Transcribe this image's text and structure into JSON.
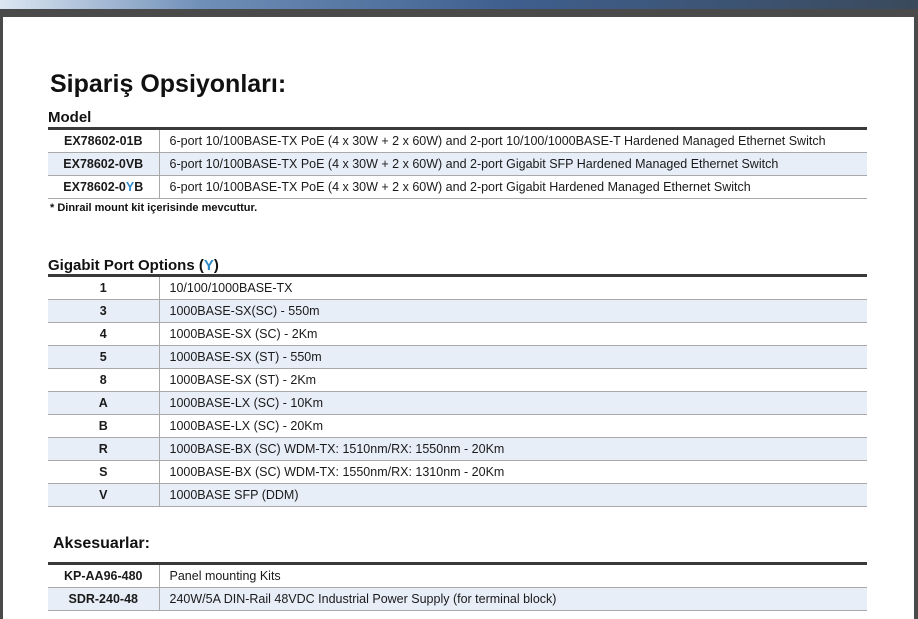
{
  "page_title": "Sipariş Opsiyonları:",
  "model_section": {
    "label": "Model",
    "rows": [
      {
        "code": "EX78602-01B",
        "desc": "6-port 10/100BASE-TX PoE (4 x 30W + 2 x 60W) and 2-port 10/100/1000BASE-T Hardened Managed Ethernet Switch"
      },
      {
        "code": "EX78602-0VB",
        "desc": "6-port 10/100BASE-TX PoE (4 x 30W + 2 x 60W) and 2-port Gigabit SFP Hardened Managed Ethernet Switch"
      },
      {
        "code_prefix": "EX78602-0",
        "code_highlight": "Y",
        "code_suffix": "B",
        "desc": "6-port 10/100BASE-TX PoE (4 x 30W + 2 x 60W) and 2-port Gigabit Hardened Managed Ethernet Switch"
      }
    ],
    "footnote": "*  Dinrail mount kit içerisinde mevcuttur."
  },
  "gigabit_section": {
    "label": "Gigabit Port Options (",
    "label_highlight": "Y",
    "label_suffix": ")",
    "rows": [
      {
        "code": "1",
        "desc": "10/100/1000BASE-TX"
      },
      {
        "code": "3",
        "desc": "1000BASE-SX(SC) - 550m"
      },
      {
        "code": "4",
        "desc": "1000BASE-SX (SC) - 2Km"
      },
      {
        "code": "5",
        "desc": "1000BASE-SX (ST) - 550m"
      },
      {
        "code": "8",
        "desc": "1000BASE-SX (ST) - 2Km"
      },
      {
        "code": "A",
        "desc": "1000BASE-LX (SC) - 10Km"
      },
      {
        "code": "B",
        "desc": "1000BASE-LX (SC) - 20Km"
      },
      {
        "code": "R",
        "desc": "1000BASE-BX (SC) WDM-TX: 1510nm/RX: 1550nm - 20Km"
      },
      {
        "code": "S",
        "desc": "1000BASE-BX (SC) WDM-TX: 1550nm/RX: 1310nm - 20Km"
      },
      {
        "code": "V",
        "desc": "1000BASE SFP (DDM)"
      }
    ]
  },
  "accessories_section": {
    "label": "Aksesuarlar:",
    "rows": [
      {
        "code": "KP-AA96-480",
        "desc": "Panel mounting Kits"
      },
      {
        "code": "SDR-240-48",
        "desc": "240W/5A DIN-Rail 48VDC Industrial Power Supply (for terminal block)"
      }
    ]
  },
  "colors": {
    "row_alt": "#e8eef8",
    "highlight": "#2b88c8",
    "rule": "#3a3a3a"
  }
}
